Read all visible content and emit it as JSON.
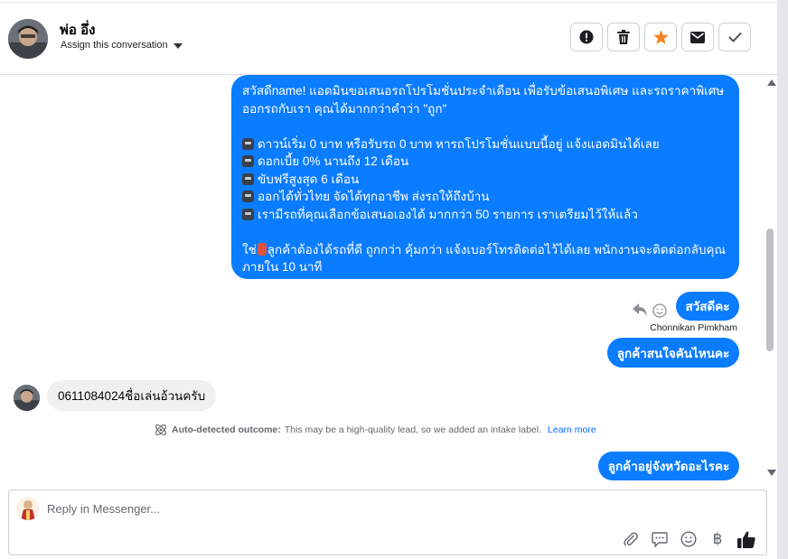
{
  "header": {
    "contact_name": "พ่อ อึ่ง",
    "assign_label": "Assign this conversation",
    "actions": [
      {
        "name": "mark-spam-button",
        "icon": "exclamation-icon"
      },
      {
        "name": "delete-button",
        "icon": "trash-icon"
      },
      {
        "name": "star-button",
        "icon": "star-icon"
      },
      {
        "name": "mark-unread-button",
        "icon": "mail-icon"
      },
      {
        "name": "mark-done-button",
        "icon": "check-icon"
      }
    ]
  },
  "messages": {
    "promo": {
      "intro": "สวัสดีname! แอดมินขอเสนอรถโปรโมชั่นประจำเดือน เพื่อรับข้อเสนอพิเศษ และรถราคาพิเศษ ออกรถกับเรา คุณได้มากกว่าคำว่า \"ถูก\"",
      "items": [
        "ดาวน์เริ่ม 0 บาท หรือรับรถ 0 บาท หารถโปรโมชั่นแบบนี้อยู่ แจ้งแอดมินได้เลย",
        "ดอกเบี้ย 0% นานถึง 12 เดือน",
        "ขับฟรีสูงสุด 6 เดือน",
        "ออกได้ทั่วไทย จัดได้ทุกอาชีพ ส่งรถให้ถึงบ้าน",
        "เรามีรถที่คุณเลือกข้อเสนอเองได้ มากกว่า 50 รายการ เราเตรียมไว้ให้แล้ว"
      ],
      "closing_before": "ใช่",
      "closing_after": "ลูกค้าต้องได้รถที่ดี ถูกกว่า คุ้มกว่า แจ้งเบอร์โทรติดต่อไว้ได้เลย พนักงานจะติดต่อกลับคุณภายใน 10 นาที"
    },
    "greeting": "สวัสดีคะ",
    "sender_name": "Chonnikan Pimkham",
    "question_car": "ลูกค้าสนใจคันไหนคะ",
    "customer_reply": "0611084024ชื่อเล่นอ้วนครับ",
    "question_province": "ลูกค้าอยู่จังหวัดอะไรคะ"
  },
  "outcome": {
    "label": "Auto-detected outcome:",
    "text": "This may be a high-quality lead, so we added an intake label.",
    "link": "Learn more"
  },
  "composer": {
    "placeholder": "Reply in Messenger...",
    "tools": [
      "paperclip-icon",
      "speech-bubble-icon",
      "emoji-icon",
      "baht-icon",
      "thumbs-up-icon"
    ],
    "baht_symbol": "฿"
  },
  "colors": {
    "outgoing_bubble": "#0a7cff",
    "incoming_bubble": "#f0f0f0",
    "star_accent": "#f5841f",
    "link": "#0866ff"
  }
}
